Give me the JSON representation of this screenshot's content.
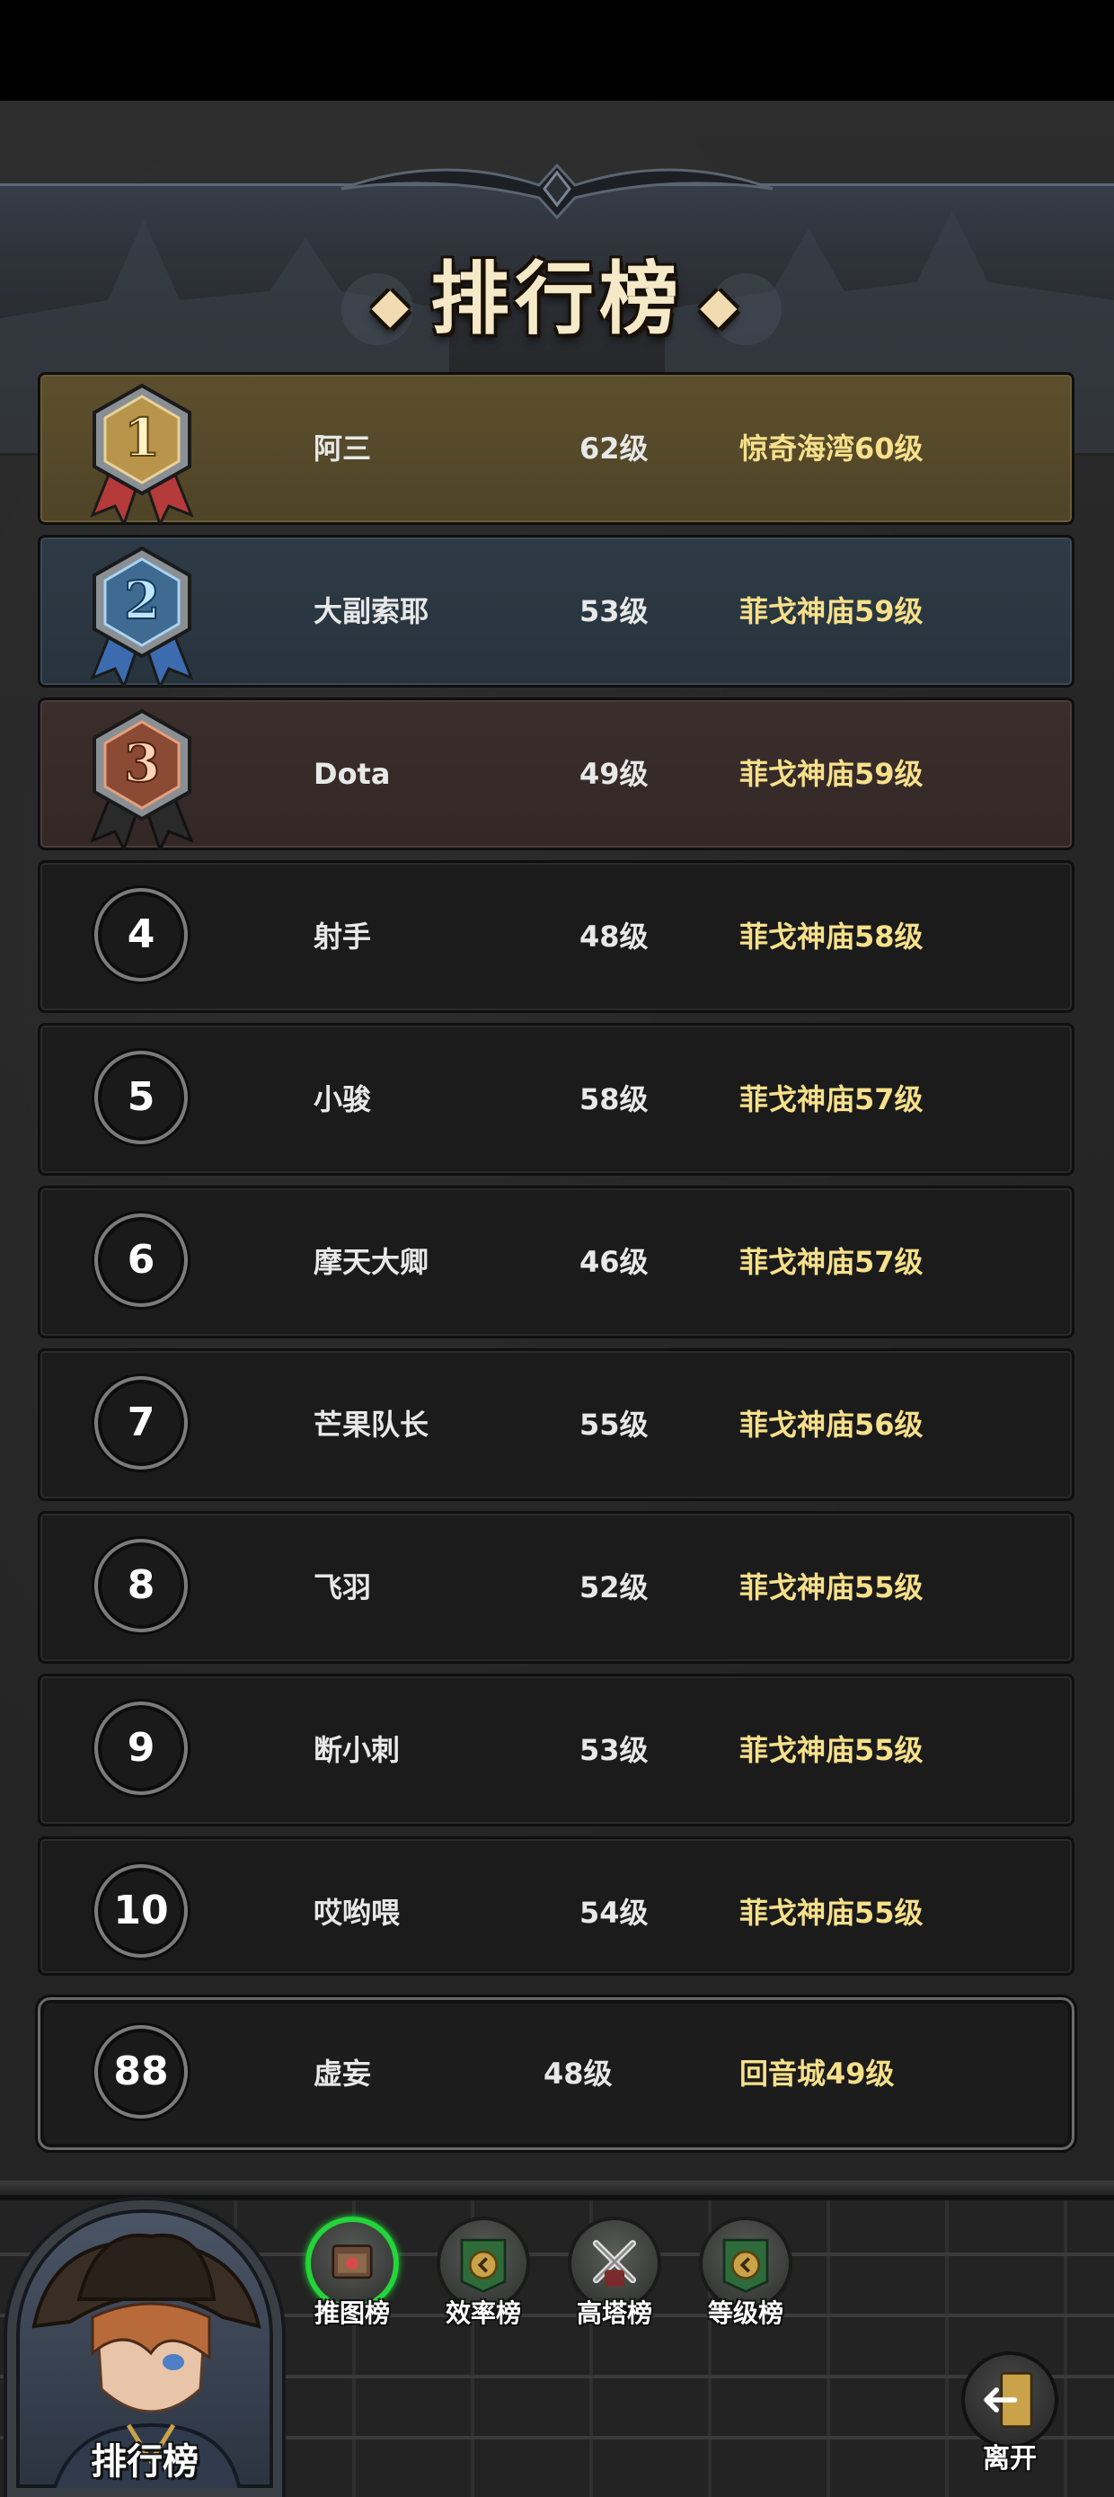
{
  "header": {
    "title": "排行榜"
  },
  "leaderboard": {
    "rows": [
      {
        "rank": "1",
        "name": "阿三",
        "level": "62级",
        "stage": "惊奇海湾60级"
      },
      {
        "rank": "2",
        "name": "大副索耶",
        "level": "53级",
        "stage": "菲戈神庙59级"
      },
      {
        "rank": "3",
        "name": "Dota",
        "level": "49级",
        "stage": "菲戈神庙59级"
      },
      {
        "rank": "4",
        "name": "射手",
        "level": "48级",
        "stage": "菲戈神庙58级"
      },
      {
        "rank": "5",
        "name": "小骏",
        "level": "58级",
        "stage": "菲戈神庙57级"
      },
      {
        "rank": "6",
        "name": "摩天大卿",
        "level": "46级",
        "stage": "菲戈神庙57级"
      },
      {
        "rank": "7",
        "name": "芒果队长",
        "level": "55级",
        "stage": "菲戈神庙56级"
      },
      {
        "rank": "8",
        "name": "飞羽",
        "level": "52级",
        "stage": "菲戈神庙55级"
      },
      {
        "rank": "9",
        "name": "断小刺",
        "level": "53级",
        "stage": "菲戈神庙55级"
      },
      {
        "rank": "10",
        "name": "哎哟喂",
        "level": "54级",
        "stage": "菲戈神庙55级"
      }
    ]
  },
  "my_rank": {
    "rank": "88",
    "name": "虚妄",
    "level": "48级",
    "stage": "回音城49级"
  },
  "tabs": [
    {
      "label": "推图榜",
      "active": true
    },
    {
      "label": "效率榜",
      "active": false
    },
    {
      "label": "高塔榜",
      "active": false
    },
    {
      "label": "等级榜",
      "active": false
    }
  ],
  "portrait": {
    "label": "排行榜"
  },
  "exit": {
    "label": "离开"
  },
  "colors": {
    "gold_row": "#5c4f2d",
    "silver_row": "#2e3b46",
    "bronze_row": "#3a2e2c",
    "stage_text": "#f7e08a",
    "active_tab": "#23d43a"
  }
}
